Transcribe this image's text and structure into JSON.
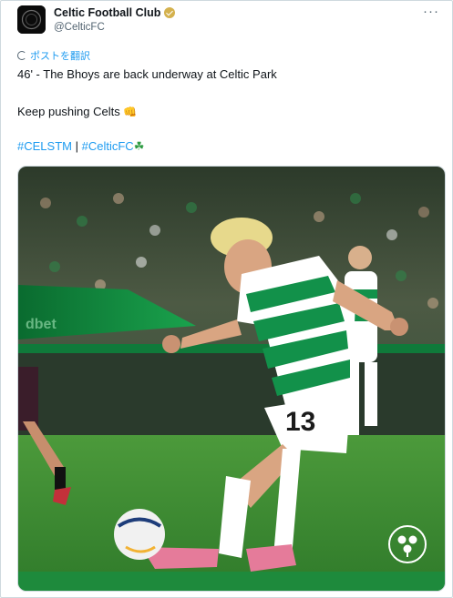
{
  "post": {
    "author_name": "Celtic Football Club",
    "author_handle": "@CelticFC",
    "verified_icon": "verified-gold-badge",
    "more_icon": "more-horizontal-icon",
    "translate_label": "ポストを翻訳",
    "line1": "46' - The Bhoys are back underway at Celtic Park",
    "line2": "Keep pushing Celts",
    "line2_emoji": "👊",
    "hashtag1": "#CELSTM",
    "separator": "|",
    "hashtag2": "#CelticFC",
    "hashtag2_emoji": "☘",
    "shirt_number": "13"
  },
  "colors": {
    "link": "#1d9bf0",
    "celtic_green": "#12914a",
    "pitch": "#3e8f34"
  }
}
